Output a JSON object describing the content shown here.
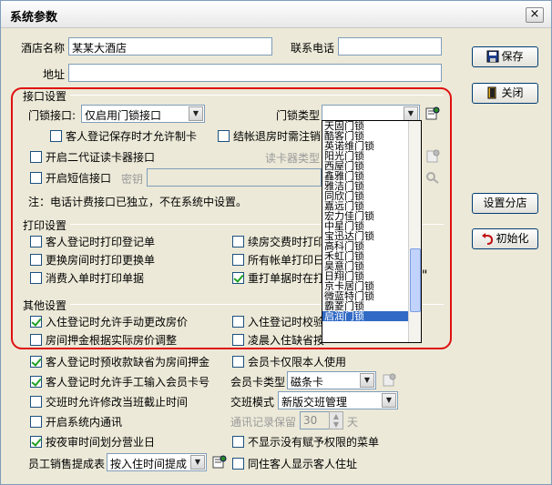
{
  "window": {
    "title": "系统参数",
    "close": "×"
  },
  "hotel": {
    "name_label": "酒店名称",
    "name_value": "某某大酒店",
    "phone_label": "联系电话",
    "phone_value": "",
    "address_label": "地址",
    "address_value": ""
  },
  "interface": {
    "group_title": "接口设置",
    "lock_if_label": "门锁接口:",
    "lock_if_value": "仅启用门锁接口",
    "lock_type_label": "门锁类型",
    "lock_type_value": "",
    "guest_save_card": "客人登记保存时才允许制卡",
    "checkout_cancel": "结帐退房时需注销",
    "second_gen_reader": "开启二代证读卡器接口",
    "reader_type_label": "读卡器类型",
    "sms_interface": "开启短信接口",
    "secret_label": "密钥",
    "note": "注：电话计费接口已独立，不在系统中设置。",
    "lock_options": [
      "天固门锁",
      "酷客门锁",
      "英诺维门锁",
      "阳光门锁",
      "西屋门锁",
      "鑫雅门锁",
      "雅洁门锁",
      "同欣门锁",
      "嘉远门锁",
      "宏力佳门锁",
      "中星门锁",
      "宝迅达门锁",
      "高科门锁",
      "禾虹门锁",
      "昊意门锁",
      "日翔门锁",
      "京卡居门锁",
      "微蓝特门锁",
      "霸菱门锁",
      "启润门锁"
    ],
    "lock_selected_index": 19
  },
  "print": {
    "group_title": "打印设置",
    "checkin_print": "客人登记时打印登记单",
    "renew_print": "续房交费时打印",
    "change_room_print": "更换房间时打印更换单",
    "all_bills_print": "所有帐单打印日",
    "consume_print": "消费入单时打印单据",
    "reprint": "重打单据时在打印",
    "quote_mark": "\""
  },
  "other": {
    "group_title": "其他设置",
    "allow_change_price": "入住登记时允许手动更改房价",
    "checkin_verify": "入住登记时校验",
    "deposit_adjust": "房间押金根据实际房价调整",
    "early_checkin": "凌晨入住缺省按",
    "prepay_default": "客人登记时预收款缺省为房间押金",
    "member_card_self": "会员卡仅限本人使用",
    "manual_member_card": "客人登记时允许手工输入会员卡号",
    "member_card_type_label": "会员卡类型",
    "member_card_type_value": "磁条卡",
    "shift_modify_time": "交班时允许修改当班截止时间",
    "shift_mode_label": "交班模式",
    "shift_mode_value": "新版交班管理",
    "intercom": "开启系统内通讯",
    "intercom_keep_label": "通讯记录保留",
    "intercom_keep_value": "30",
    "intercom_keep_unit": "天",
    "night_audit": "按夜审时间划分营业日",
    "hide_unauth_menu": "不显示没有赋予权限的菜单",
    "sales_report_label": "员工销售提成表",
    "sales_report_value": "按入住时间提成",
    "same_guest_address": "同住客人显示客人住址"
  },
  "buttons": {
    "save": "保存",
    "close": "关闭",
    "set_branch": "设置分店",
    "initialize": "初始化"
  },
  "checked": {
    "guest_save_card": false,
    "checkout_cancel": false,
    "second_gen_reader": false,
    "sms_interface": false,
    "checkin_print": false,
    "renew_print": false,
    "change_room_print": false,
    "all_bills_print": false,
    "consume_print": false,
    "reprint": true,
    "allow_change_price": true,
    "checkin_verify": false,
    "deposit_adjust": false,
    "early_checkin": false,
    "prepay_default": true,
    "member_card_self": false,
    "manual_member_card": true,
    "shift_modify_time": false,
    "intercom": false,
    "night_audit": true,
    "hide_unauth_menu": false,
    "same_guest_address": false
  },
  "colors": {
    "highlight_frame": "#e01010",
    "selection": "#316ac5",
    "check": "#21a121"
  }
}
